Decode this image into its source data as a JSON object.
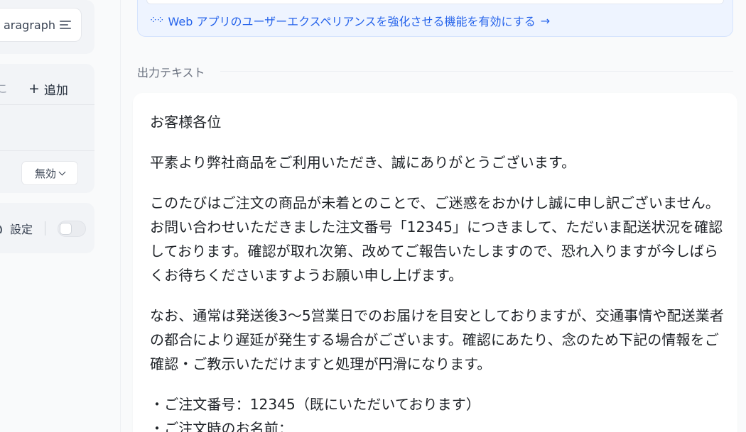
{
  "left_panel": {
    "format_select": {
      "value": "aragraph"
    },
    "list_section": {
      "cut_char": "こ",
      "add_label": "追加",
      "status_select": {
        "value": "無効"
      }
    },
    "settings_section": {
      "label": "設定",
      "toggle_on": false
    }
  },
  "feature_banner": {
    "link_text": "Web アプリのユーザーエクスペリアンスを強化させる機能を有効にする",
    "arrow": "→",
    "icon": "sparkle-grid-icon"
  },
  "output": {
    "section_title": "出力テキスト",
    "paragraphs": [
      "お客様各位",
      "平素より弊社商品をご利用いただき、誠にありがとうございます。",
      "このたびはご注文の商品が未着とのことで、ご迷惑をおかけし誠に申し訳ございません。お問い合わせいただきました注文番号「12345」につきまして、ただいま配送状況を確認しております。確認が取れ次第、改めてご報告いたしますので、恐れ入りますが今しばらくお待ちくださいますようお願い申し上げます。",
      "なお、通常は発送後3～5営業日でのお届けを目安としておりますが、交通事情や配送業者の都合により遅延が発生する場合がございます。確認にあたり、念のため下記の情報をご確認・ご教示いただけますと処理が円滑になります。"
    ],
    "bullets": [
      "・ご注文番号：12345（既にいただいております）",
      "・ご注文時のお名前："
    ]
  },
  "colors": {
    "accent": "#2563eb",
    "banner_bg": "#eef4ff",
    "panel_bg": "#f2f4f7"
  }
}
